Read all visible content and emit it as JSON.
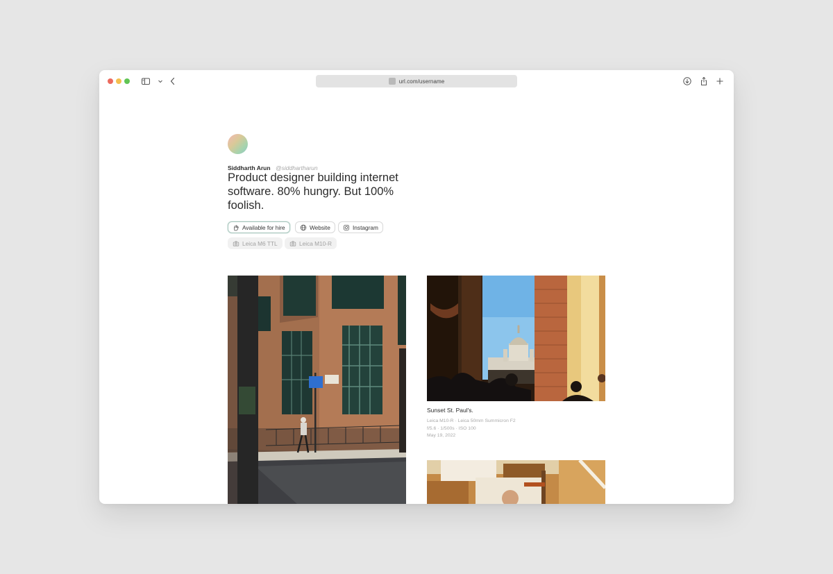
{
  "browser": {
    "url": "url.com/username",
    "traffic_lights": [
      "#ec6a5e",
      "#f4bf4f",
      "#61c554"
    ]
  },
  "profile": {
    "name": "Siddharth Arun",
    "handle": "@siddhartharun",
    "bio": "Product designer building internet software. 80% hungry. But 100% foolish."
  },
  "links": [
    {
      "label": "Available for hire",
      "icon": "hand-icon"
    },
    {
      "label": "Website",
      "icon": "globe-icon"
    },
    {
      "label": "Instagram",
      "icon": "instagram-icon"
    }
  ],
  "cameras": [
    {
      "label": "Leica M6 TTL",
      "icon": "camera-icon"
    },
    {
      "label": "Leica M10-R",
      "icon": "camera-icon"
    }
  ],
  "featured_photo": {
    "title": "Sunset St. Paul's.",
    "gear": "Leica M10-R · Leica 50mm Summicron F2",
    "settings": "f/5.6 · 1/500s · ISO 100",
    "date": "May 19, 2022"
  }
}
